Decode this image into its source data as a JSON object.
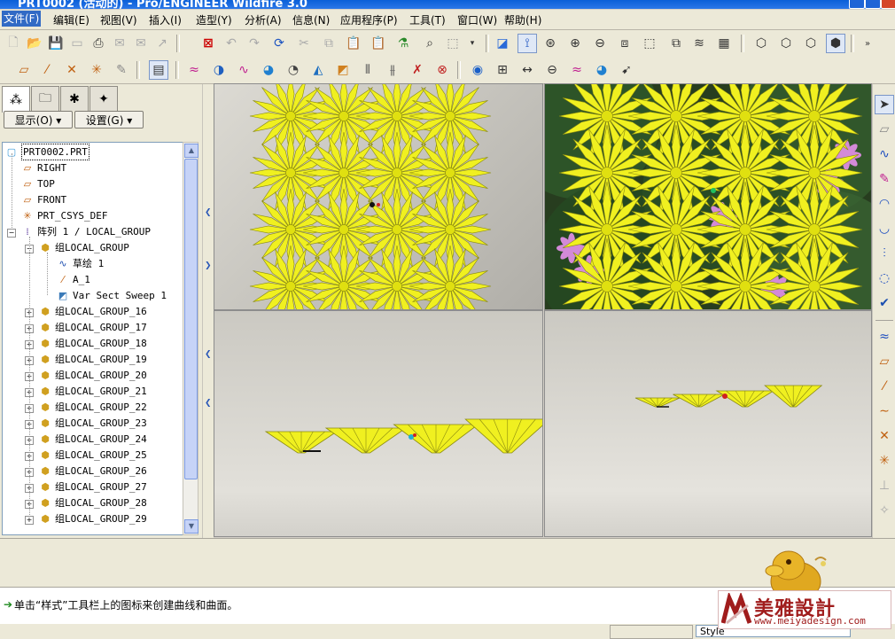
{
  "window": {
    "title": "PRT0002 (活动的) - Pro/ENGINEER Wildfire 3.0"
  },
  "menu": [
    {
      "label": "文件(F)",
      "active": true
    },
    {
      "label": "编辑(E)"
    },
    {
      "label": "视图(V)"
    },
    {
      "label": "插入(I)"
    },
    {
      "label": "造型(Y)"
    },
    {
      "label": "分析(A)"
    },
    {
      "label": "信息(N)"
    },
    {
      "label": "应用程序(P)"
    },
    {
      "label": "工具(T)"
    },
    {
      "label": "窗口(W)"
    },
    {
      "label": "帮助(H)"
    }
  ],
  "navigator": {
    "show_button": "显示(O) ▾",
    "settings_button": "设置(G) ▾",
    "tree": [
      {
        "label": "PRT0002.PRT",
        "icon": "part-icon"
      },
      {
        "label": "RIGHT",
        "icon": "datum-plane-icon"
      },
      {
        "label": "TOP",
        "icon": "datum-plane-icon"
      },
      {
        "label": "FRONT",
        "icon": "datum-plane-icon"
      },
      {
        "label": "PRT_CSYS_DEF",
        "icon": "csys-icon"
      },
      {
        "label": "阵列 1 / LOCAL_GROUP",
        "icon": "pattern-icon"
      },
      {
        "label": "组LOCAL_GROUP",
        "icon": "group-icon"
      },
      {
        "label": "草绘 1",
        "icon": "sketch-icon"
      },
      {
        "label": "A_1",
        "icon": "axis-icon"
      },
      {
        "label": "Var Sect Sweep 1",
        "icon": "sweep-icon"
      },
      {
        "label": "组LOCAL_GROUP_16",
        "icon": "group-icon"
      },
      {
        "label": "组LOCAL_GROUP_17",
        "icon": "group-icon"
      },
      {
        "label": "组LOCAL_GROUP_18",
        "icon": "group-icon"
      },
      {
        "label": "组LOCAL_GROUP_19",
        "icon": "group-icon"
      },
      {
        "label": "组LOCAL_GROUP_20",
        "icon": "group-icon"
      },
      {
        "label": "组LOCAL_GROUP_21",
        "icon": "group-icon"
      },
      {
        "label": "组LOCAL_GROUP_22",
        "icon": "group-icon"
      },
      {
        "label": "组LOCAL_GROUP_23",
        "icon": "group-icon"
      },
      {
        "label": "组LOCAL_GROUP_24",
        "icon": "group-icon"
      },
      {
        "label": "组LOCAL_GROUP_25",
        "icon": "group-icon"
      },
      {
        "label": "组LOCAL_GROUP_26",
        "icon": "group-icon"
      },
      {
        "label": "组LOCAL_GROUP_27",
        "icon": "group-icon"
      },
      {
        "label": "组LOCAL_GROUP_28",
        "icon": "group-icon"
      },
      {
        "label": "组LOCAL_GROUP_29",
        "icon": "group-icon"
      }
    ]
  },
  "message": "单击“样式”工具栏上的图标来创建曲线和曲面。",
  "status": {
    "style_field": "Style"
  },
  "logo": {
    "main": "美雅設計",
    "url": "www.meiyadesign.com"
  },
  "colors": {
    "accent": "#316ac5",
    "petal": "#f0f020",
    "petal_edge": "#8a8a10"
  }
}
